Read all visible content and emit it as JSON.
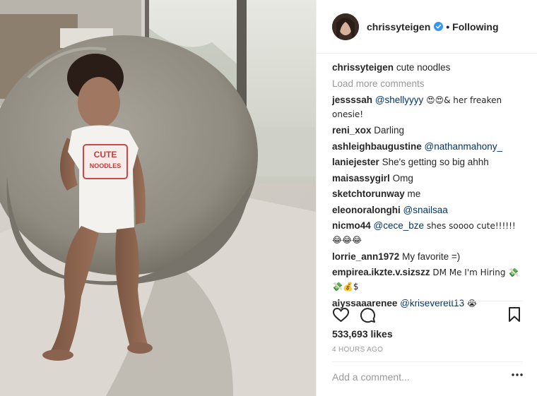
{
  "post": {
    "username": "chrissyteigen",
    "verified": true,
    "follow_status": "Following",
    "separator": "•",
    "caption_user": "chrissyteigen",
    "caption_text": "cute noodles",
    "load_more": "Load more comments",
    "comments": [
      {
        "user": "jessssah",
        "mention": "@shellyyyy",
        "text": "😍😍& her freaken onesie!"
      },
      {
        "user": "reni_xox",
        "mention": "",
        "text": "Darling"
      },
      {
        "user": "ashleighbaugustine",
        "mention": "@nathanmahony_",
        "text": ""
      },
      {
        "user": "laniejester",
        "mention": "",
        "text": "She's getting so big ahhh"
      },
      {
        "user": "maisassygirl",
        "mention": "",
        "text": "Omg"
      },
      {
        "user": "sketchtorunway",
        "mention": "",
        "text": "me"
      },
      {
        "user": "eleonoralonghi",
        "mention": "@snailsaa",
        "text": ""
      },
      {
        "user": "nicmo44",
        "mention": "@cece_bze",
        "text": "shes soooo cute!!!!!! 😂😂😂"
      },
      {
        "user": "lorrie_ann1972",
        "mention": "",
        "text": "My favorite =)"
      },
      {
        "user": "empirea.ikzte.v.sizszz",
        "mention": "",
        "text": "DM Me I'm Hiring 💸💸💰$"
      },
      {
        "user": "alyssaaarenee",
        "mention": "@kriseverett13",
        "text": "😭"
      }
    ],
    "likes": "533,693 likes",
    "timestamp": "4 HOURS AGO",
    "comment_placeholder": "Add a comment...",
    "icons": {
      "like": "heart-icon",
      "comment": "comment-icon",
      "save": "bookmark-icon",
      "more": "more-options-icon",
      "verified": "verified-badge-icon"
    },
    "colors": {
      "verified_blue": "#3897f0",
      "text": "#262626",
      "muted": "#999999",
      "mention": "#003569"
    }
  },
  "photo": {
    "onesie_text_top": "CUTE",
    "onesie_text_bottom": "NOODLES"
  }
}
